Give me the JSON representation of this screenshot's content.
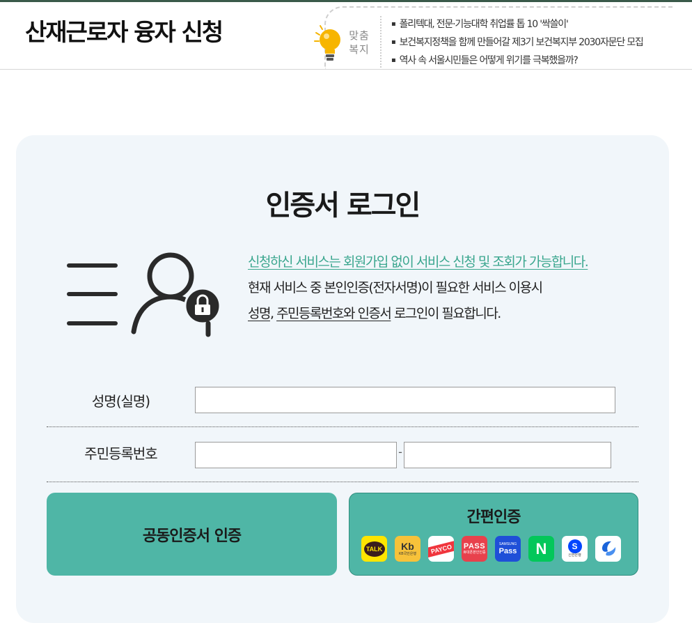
{
  "header": {
    "title": "산재근로자 융자 신청",
    "welfare_label_line1": "맞춤",
    "welfare_label_line2": "복지",
    "news": [
      "폴리텍대, 전문·기능대학 취업률 톱 10 '싹쓸이'",
      "보건복지정책을 함께 만들어갈 제3기 보건복지부 2030자문단 모집",
      "역사 속 서울시민들은 어떻게 위기를 극복했을까?"
    ]
  },
  "login": {
    "title": "인증서 로그인",
    "desc_line1": "신청하신 서비스는 회원가입 없이 서비스 신청 및 조회가 가능합니다.",
    "desc_line2": "현재 서비스 중 본인인증(전자서명)이 필요한 서비스 이용시",
    "desc_line3_a": "성명",
    "desc_line3_b": ", ",
    "desc_line3_c": "주민등록번호와 인증서",
    "desc_line3_d": " 로그인이 필요합니다."
  },
  "form": {
    "name_label": "성명(실명)",
    "name_value": "",
    "rrn_label": "주민등록번호",
    "rrn_front_value": "",
    "rrn_back_value": "",
    "rrn_separator": "-"
  },
  "buttons": {
    "joint_cert": "공동인증서 인증",
    "easy_auth": "간편인증"
  },
  "providers": {
    "kakao": "TALK",
    "kb_mark": "Kb",
    "kb_text": "KB국민은행",
    "payco": "PAYCO",
    "pass": "PASS",
    "pass_sub": "휴대폰본인인증",
    "samsung_top": "SAMSUNG",
    "samsung": "Pass",
    "naver": "N",
    "shinhan_mark": "S",
    "shinhan": "신한은행"
  },
  "colors": {
    "accent": "#4fb6a6",
    "link": "#3aa68e",
    "card_bg": "#f1f6fa"
  }
}
